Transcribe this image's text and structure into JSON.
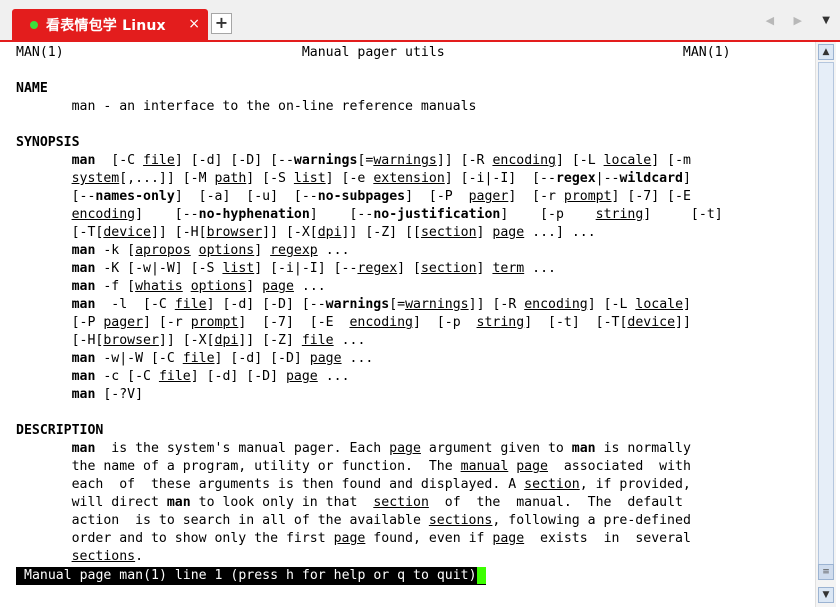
{
  "window": {
    "tab_title": "看表情包学 Linux",
    "close_glyph": "×",
    "new_tab_glyph": "+",
    "nav_arrows": "◀ ▶",
    "menu_glyph": "▼",
    "accent_color": "#e31d1d",
    "status_dot_color": "#3be03b"
  },
  "man_page": {
    "lines": [
      [
        {
          "t": "MAN(1)                              Manual pager utils                              MAN(1)"
        }
      ],
      [
        {
          "t": ""
        }
      ],
      [
        {
          "t": "NAME",
          "b": true
        }
      ],
      [
        {
          "t": "       man - an interface to the on-line reference manuals"
        }
      ],
      [
        {
          "t": ""
        }
      ],
      [
        {
          "t": "SYNOPSIS",
          "b": true
        }
      ],
      [
        {
          "t": "       "
        },
        {
          "t": "man",
          "b": true
        },
        {
          "t": "  [-C "
        },
        {
          "t": "file",
          "u": true
        },
        {
          "t": "] [-d] [-D] [--"
        },
        {
          "t": "warnings",
          "b": true
        },
        {
          "t": "[="
        },
        {
          "t": "warnings",
          "u": true
        },
        {
          "t": "]] [-R "
        },
        {
          "t": "encoding",
          "u": true
        },
        {
          "t": "] [-L "
        },
        {
          "t": "locale",
          "u": true
        },
        {
          "t": "] [-m"
        }
      ],
      [
        {
          "t": "       "
        },
        {
          "t": "system",
          "u": true
        },
        {
          "t": "[,...]] [-M "
        },
        {
          "t": "path",
          "u": true
        },
        {
          "t": "] [-S "
        },
        {
          "t": "list",
          "u": true
        },
        {
          "t": "] [-e "
        },
        {
          "t": "extension",
          "u": true
        },
        {
          "t": "] [-i|-I]  [--"
        },
        {
          "t": "regex",
          "b": true
        },
        {
          "t": "|--"
        },
        {
          "t": "wildcard",
          "b": true
        },
        {
          "t": "]"
        }
      ],
      [
        {
          "t": "       [--"
        },
        {
          "t": "names-only",
          "b": true
        },
        {
          "t": "]  [-a]  [-u]  [--"
        },
        {
          "t": "no-subpages",
          "b": true
        },
        {
          "t": "]  [-P  "
        },
        {
          "t": "pager",
          "u": true
        },
        {
          "t": "]  [-r "
        },
        {
          "t": "prompt",
          "u": true
        },
        {
          "t": "] [-7] [-E"
        }
      ],
      [
        {
          "t": "       "
        },
        {
          "t": "encoding",
          "u": true
        },
        {
          "t": "]    [--"
        },
        {
          "t": "no-hyphenation",
          "b": true
        },
        {
          "t": "]    [--"
        },
        {
          "t": "no-justification",
          "b": true
        },
        {
          "t": "]    [-p    "
        },
        {
          "t": "string",
          "u": true
        },
        {
          "t": "]     [-t]"
        }
      ],
      [
        {
          "t": "       [-T["
        },
        {
          "t": "device",
          "u": true
        },
        {
          "t": "]] [-H["
        },
        {
          "t": "browser",
          "u": true
        },
        {
          "t": "]] [-X["
        },
        {
          "t": "dpi",
          "u": true
        },
        {
          "t": "]] [-Z] [["
        },
        {
          "t": "section",
          "u": true
        },
        {
          "t": "] "
        },
        {
          "t": "page",
          "u": true
        },
        {
          "t": " ...] ..."
        }
      ],
      [
        {
          "t": "       "
        },
        {
          "t": "man",
          "b": true
        },
        {
          "t": " -k ["
        },
        {
          "t": "apropos",
          "u": true
        },
        {
          "t": " "
        },
        {
          "t": "options",
          "u": true
        },
        {
          "t": "] "
        },
        {
          "t": "regexp",
          "u": true
        },
        {
          "t": " ..."
        }
      ],
      [
        {
          "t": "       "
        },
        {
          "t": "man",
          "b": true
        },
        {
          "t": " -K [-w|-W] [-S "
        },
        {
          "t": "list",
          "u": true
        },
        {
          "t": "] [-i|-I] [--"
        },
        {
          "t": "regex",
          "u": true
        },
        {
          "t": "] ["
        },
        {
          "t": "section",
          "u": true
        },
        {
          "t": "] "
        },
        {
          "t": "term",
          "u": true
        },
        {
          "t": " ..."
        }
      ],
      [
        {
          "t": "       "
        },
        {
          "t": "man",
          "b": true
        },
        {
          "t": " -f ["
        },
        {
          "t": "whatis",
          "u": true
        },
        {
          "t": " "
        },
        {
          "t": "options",
          "u": true
        },
        {
          "t": "] "
        },
        {
          "t": "page",
          "u": true
        },
        {
          "t": " ..."
        }
      ],
      [
        {
          "t": "       "
        },
        {
          "t": "man",
          "b": true
        },
        {
          "t": "  -l  [-C "
        },
        {
          "t": "file",
          "u": true
        },
        {
          "t": "] [-d] [-D] [--"
        },
        {
          "t": "warnings",
          "b": true
        },
        {
          "t": "[="
        },
        {
          "t": "warnings",
          "u": true
        },
        {
          "t": "]] [-R "
        },
        {
          "t": "encoding",
          "u": true
        },
        {
          "t": "] [-L "
        },
        {
          "t": "locale",
          "u": true
        },
        {
          "t": "]"
        }
      ],
      [
        {
          "t": "       [-P "
        },
        {
          "t": "pager",
          "u": true
        },
        {
          "t": "] [-r "
        },
        {
          "t": "prompt",
          "u": true
        },
        {
          "t": "]  [-7]  [-E  "
        },
        {
          "t": "encoding",
          "u": true
        },
        {
          "t": "]  [-p  "
        },
        {
          "t": "string",
          "u": true
        },
        {
          "t": "]  [-t]  [-T["
        },
        {
          "t": "device",
          "u": true
        },
        {
          "t": "]]"
        }
      ],
      [
        {
          "t": "       [-H["
        },
        {
          "t": "browser",
          "u": true
        },
        {
          "t": "]] [-X["
        },
        {
          "t": "dpi",
          "u": true
        },
        {
          "t": "]] [-Z] "
        },
        {
          "t": "file",
          "u": true
        },
        {
          "t": " ..."
        }
      ],
      [
        {
          "t": "       "
        },
        {
          "t": "man",
          "b": true
        },
        {
          "t": " -w|-W [-C "
        },
        {
          "t": "file",
          "u": true
        },
        {
          "t": "] [-d] [-D] "
        },
        {
          "t": "page",
          "u": true
        },
        {
          "t": " ..."
        }
      ],
      [
        {
          "t": "       "
        },
        {
          "t": "man",
          "b": true
        },
        {
          "t": " -c [-C "
        },
        {
          "t": "file",
          "u": true
        },
        {
          "t": "] [-d] [-D] "
        },
        {
          "t": "page",
          "u": true
        },
        {
          "t": " ..."
        }
      ],
      [
        {
          "t": "       "
        },
        {
          "t": "man",
          "b": true
        },
        {
          "t": " [-?V]"
        }
      ],
      [
        {
          "t": ""
        }
      ],
      [
        {
          "t": "DESCRIPTION",
          "b": true
        }
      ],
      [
        {
          "t": "       "
        },
        {
          "t": "man",
          "b": true
        },
        {
          "t": "  is the system's manual pager. Each "
        },
        {
          "t": "page",
          "u": true
        },
        {
          "t": " argument given to "
        },
        {
          "t": "man",
          "b": true
        },
        {
          "t": " is normally"
        }
      ],
      [
        {
          "t": "       the name of a program, utility or function.  The "
        },
        {
          "t": "manual",
          "u": true
        },
        {
          "t": " "
        },
        {
          "t": "page",
          "u": true
        },
        {
          "t": "  associated  with"
        }
      ],
      [
        {
          "t": "       each  of  these arguments is then found and displayed. A "
        },
        {
          "t": "section",
          "u": true
        },
        {
          "t": ", if provided,"
        }
      ],
      [
        {
          "t": "       will direct "
        },
        {
          "t": "man",
          "b": true
        },
        {
          "t": " to look only in that  "
        },
        {
          "t": "section",
          "u": true
        },
        {
          "t": "  of  the  manual.  The  default"
        }
      ],
      [
        {
          "t": "       action  is to search in all of the available "
        },
        {
          "t": "sections",
          "u": true
        },
        {
          "t": ", following a pre-defined"
        }
      ],
      [
        {
          "t": "       order and to show only the first "
        },
        {
          "t": "page",
          "u": true
        },
        {
          "t": " found, even if "
        },
        {
          "t": "page",
          "u": true
        },
        {
          "t": "  exists  in  several"
        }
      ],
      [
        {
          "t": "       "
        },
        {
          "t": "sections",
          "u": true
        },
        {
          "t": "."
        }
      ]
    ],
    "status_line": "Manual page man(1) line 1 (press h for help or q to quit)",
    "cursor_color": "#3cff00"
  }
}
